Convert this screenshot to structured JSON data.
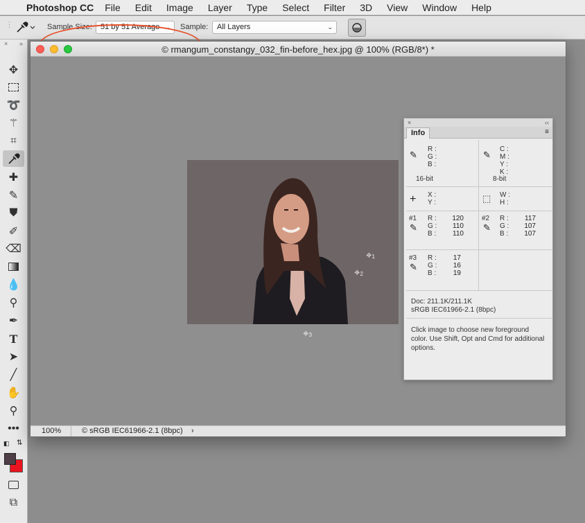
{
  "menubar": {
    "app_name": "Photoshop CC",
    "items": [
      "File",
      "Edit",
      "Image",
      "Layer",
      "Type",
      "Select",
      "Filter",
      "3D",
      "View",
      "Window",
      "Help"
    ]
  },
  "options": {
    "sample_size_label": "Sample Size:",
    "sample_size_value": "51 by 51 Average",
    "sample_label": "Sample:",
    "sample_value": "All Layers"
  },
  "document": {
    "title": "© rmangum_constangy_032_fin-before_hex.jpg @ 100% (RGB/8*) *",
    "zoom": "100%",
    "profile": "© sRGB IEC61966-2.1 (8bpc)"
  },
  "colors": {
    "foreground": "#4d3f45",
    "background": "#ea1520",
    "highlight": "#e9512b"
  },
  "info": {
    "tab": "Info",
    "rgb_labels": [
      "R :",
      "G :",
      "B :"
    ],
    "cmyk_labels": [
      "C :",
      "M :",
      "Y :",
      "K :"
    ],
    "bits_left": "16-bit",
    "bits_right": "8-bit",
    "xy_labels": [
      "X :",
      "Y :"
    ],
    "wh_labels": [
      "W :",
      "H :"
    ],
    "samplers": [
      {
        "id": "#1",
        "R": "120",
        "G": "110",
        "B": "110"
      },
      {
        "id": "#2",
        "R": "117",
        "G": "107",
        "B": "107"
      },
      {
        "id": "#3",
        "R": "17",
        "G": "16",
        "B": "19"
      }
    ],
    "doc_size": "Doc: 211.1K/211.1K",
    "doc_profile": "sRGB IEC61966-2.1 (8bpc)",
    "hint": "Click image to choose new foreground color.  Use Shift, Opt and Cmd for additional options."
  },
  "markers": [
    "1",
    "2",
    "3"
  ]
}
